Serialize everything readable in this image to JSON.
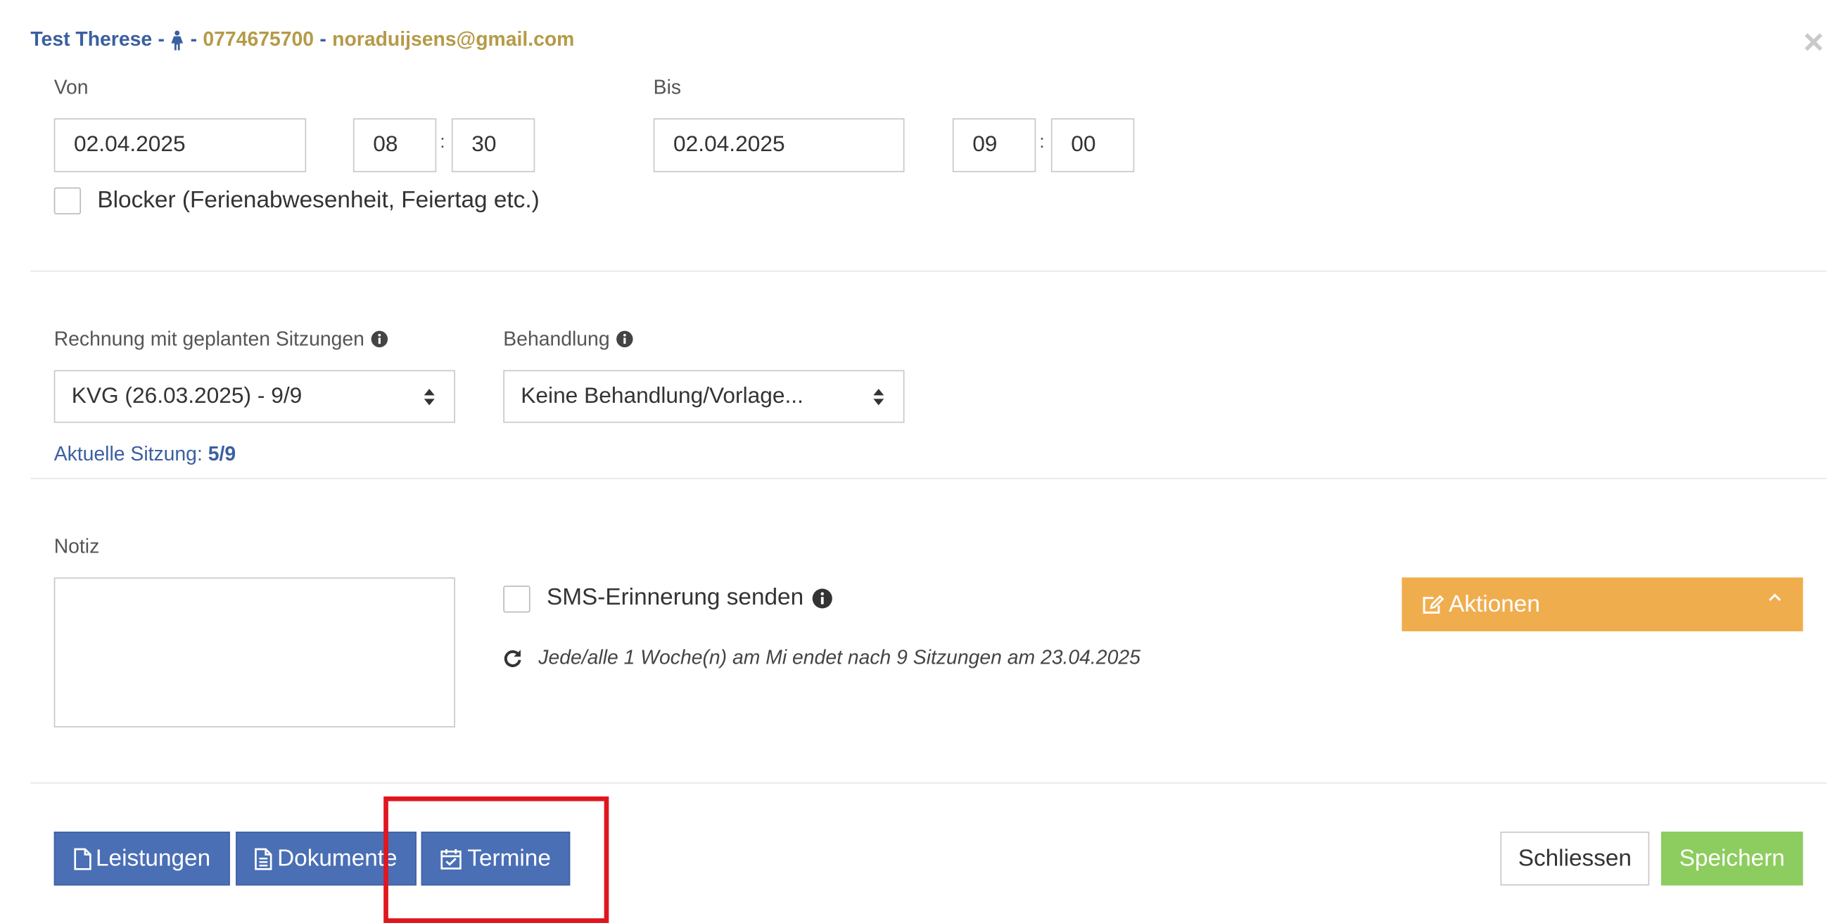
{
  "header": {
    "name": "Test Therese",
    "separator": "-",
    "phone": "0774675700",
    "email": "noraduijsens@gmail.com",
    "gender_icon": "female-person-icon"
  },
  "from": {
    "label": "Von",
    "date": "02.04.2025",
    "hour": "08",
    "minute": "30"
  },
  "to": {
    "label": "Bis",
    "date": "02.04.2025",
    "hour": "09",
    "minute": "00"
  },
  "time_separator": ":",
  "blocker": {
    "label": "Blocker (Ferienabwesenheit, Feiertag etc.)",
    "checked": false
  },
  "invoice": {
    "label": "Rechnung mit geplanten Sitzungen",
    "selected": "KVG (26.03.2025) - 9/9"
  },
  "treatment": {
    "label": "Behandlung",
    "selected": "Keine Behandlung/Vorlage..."
  },
  "session": {
    "label": "Aktuelle Sitzung:",
    "value": "5/9"
  },
  "note": {
    "label": "Notiz",
    "value": ""
  },
  "sms": {
    "label": "SMS-Erinnerung senden",
    "checked": false
  },
  "recurrence": {
    "text": "Jede/alle 1 Woche(n) am Mi endet nach 9 Sitzungen am 23.04.2025"
  },
  "actions": {
    "label": "Aktionen"
  },
  "footer": {
    "leistungen": "Leistungen",
    "dokumente": "Dokumente",
    "termine": "Termine",
    "schliessen": "Schliessen",
    "speichern": "Speichern"
  },
  "colors": {
    "primary": "#4a6fb5",
    "link": "#3b5fa0",
    "gold": "#b59a48",
    "warning": "#f0ad4e",
    "success": "#8dcc5e",
    "highlight": "#e0161f"
  }
}
